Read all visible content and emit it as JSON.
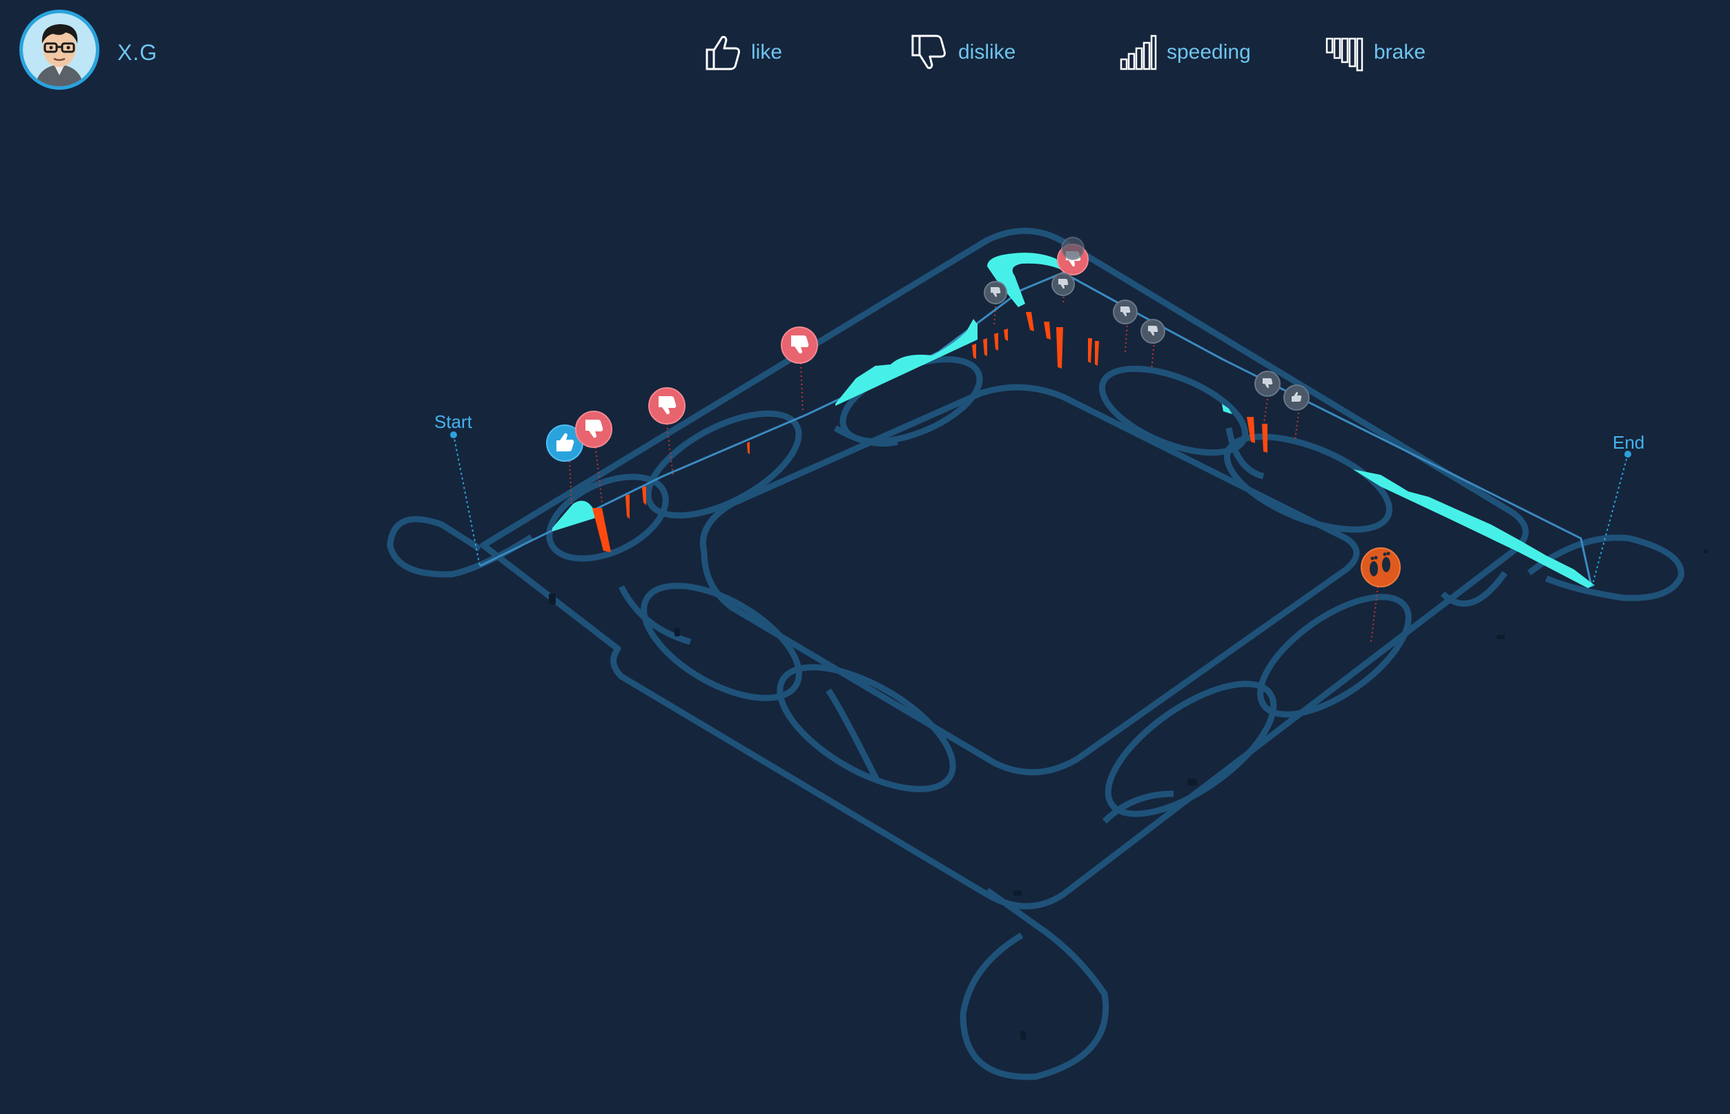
{
  "user": {
    "name": "X.G"
  },
  "legend": [
    {
      "id": "like",
      "label": "like",
      "icon": "thumbs-up-icon"
    },
    {
      "id": "dislike",
      "label": "dislike",
      "icon": "thumbs-down-icon"
    },
    {
      "id": "speeding",
      "label": "speeding",
      "icon": "signal-bars-icon"
    },
    {
      "id": "brake",
      "label": "brake",
      "icon": "brake-bars-icon"
    }
  ],
  "route": {
    "start_label": "Start",
    "end_label": "End"
  },
  "colors": {
    "background": "#15253c",
    "track": "#1f5279",
    "speed_area": "#46f0e8",
    "brake_spike": "#ff4a0f",
    "dislike_pin": "#e8646e",
    "like_pin": "#2aa3dd",
    "inactive_pin": "#4b5868",
    "footprint_pin": "#e05a1e",
    "label_text": "#6ec4ee"
  },
  "pins": [
    {
      "type": "like",
      "icon": "thumbs-up-icon",
      "state": "active"
    },
    {
      "type": "dislike",
      "icon": "thumbs-down-icon",
      "state": "active"
    },
    {
      "type": "dislike",
      "icon": "thumbs-down-icon",
      "state": "active"
    },
    {
      "type": "dislike",
      "icon": "thumbs-down-icon",
      "state": "active"
    },
    {
      "type": "dislike",
      "icon": "thumbs-down-icon",
      "state": "active"
    },
    {
      "type": "dislike",
      "icon": "thumbs-down-icon",
      "state": "inactive"
    },
    {
      "type": "dislike",
      "icon": "thumbs-down-icon",
      "state": "inactive"
    },
    {
      "type": "dislike",
      "icon": "thumbs-down-icon",
      "state": "inactive"
    },
    {
      "type": "dislike",
      "icon": "thumbs-down-icon",
      "state": "inactive"
    },
    {
      "type": "dislike",
      "icon": "thumbs-down-icon",
      "state": "inactive"
    },
    {
      "type": "dislike",
      "icon": "thumbs-down-icon",
      "state": "inactive"
    },
    {
      "type": "like",
      "icon": "thumbs-up-icon",
      "state": "inactive"
    },
    {
      "type": "location",
      "icon": "footprints-icon",
      "state": "active"
    }
  ]
}
